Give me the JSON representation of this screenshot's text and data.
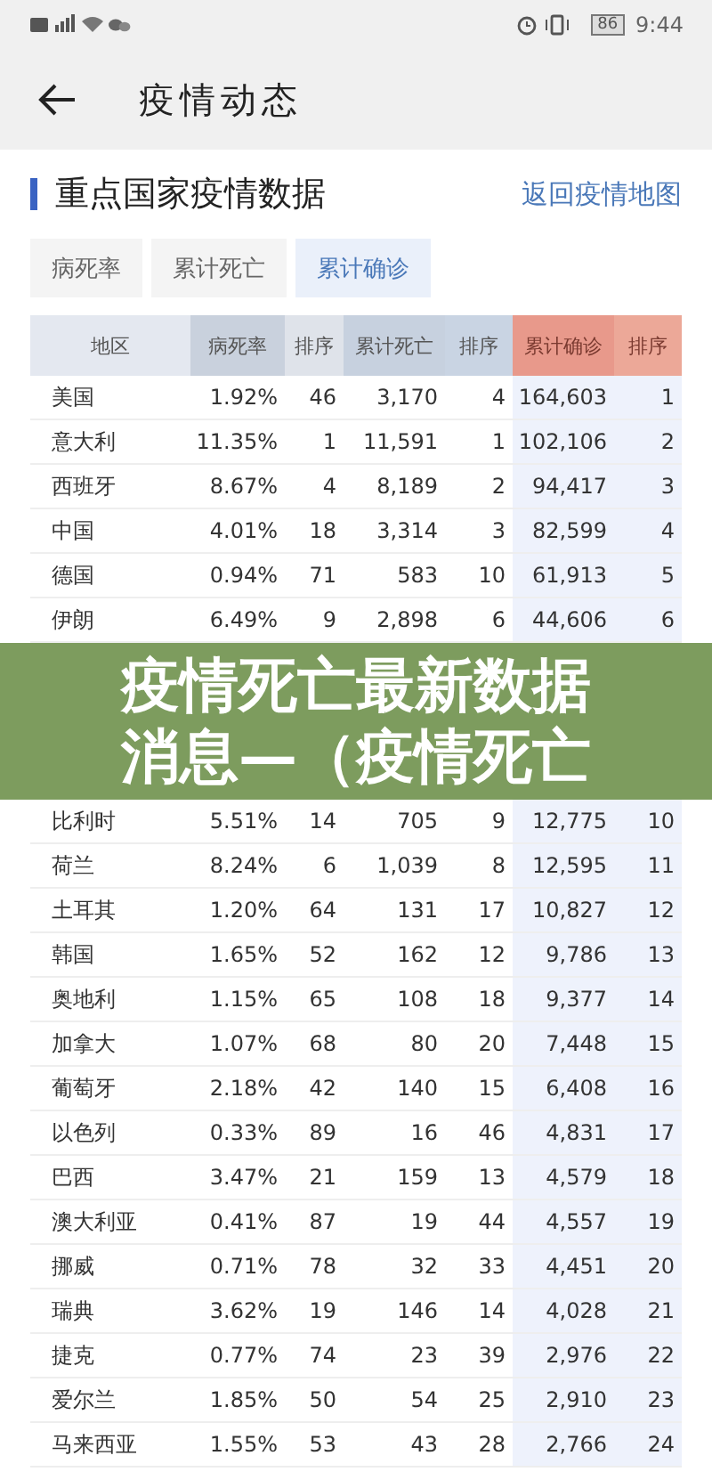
{
  "status_bar": {
    "battery": "86",
    "time": "9:44"
  },
  "header": {
    "title": "疫情动态"
  },
  "section": {
    "title": "重点国家疫情数据",
    "link": "返回疫情地图"
  },
  "tabs": [
    {
      "label": "病死率",
      "selected": false
    },
    {
      "label": "累计死亡",
      "selected": false
    },
    {
      "label": "累计确诊",
      "selected": true
    }
  ],
  "table": {
    "columns": [
      {
        "label": "地区",
        "sorted": false
      },
      {
        "label": "病死率",
        "sorted": false
      },
      {
        "label": "排序",
        "sorted": false
      },
      {
        "label": "累计死亡",
        "sorted": false
      },
      {
        "label": "排序",
        "sorted": false
      },
      {
        "label": "累计确诊",
        "sorted": true
      },
      {
        "label": "排序",
        "sorted": true
      }
    ],
    "rows": [
      [
        "美国",
        "1.92%",
        "46",
        "3,170",
        "4",
        "164,603",
        "1"
      ],
      [
        "意大利",
        "11.35%",
        "1",
        "11,591",
        "1",
        "102,106",
        "2"
      ],
      [
        "西班牙",
        "8.67%",
        "4",
        "8,189",
        "2",
        "94,417",
        "3"
      ],
      [
        "中国",
        "4.01%",
        "18",
        "3,314",
        "3",
        "82,599",
        "4"
      ],
      [
        "德国",
        "0.94%",
        "71",
        "583",
        "10",
        "61,913",
        "5"
      ],
      [
        "伊朗",
        "6.49%",
        "9",
        "2,898",
        "6",
        "44,606",
        "6"
      ]
    ],
    "rows_below_banner": [
      [
        "比利时",
        "5.51%",
        "14",
        "705",
        "9",
        "12,775",
        "10"
      ],
      [
        "荷兰",
        "8.24%",
        "6",
        "1,039",
        "8",
        "12,595",
        "11"
      ],
      [
        "土耳其",
        "1.20%",
        "64",
        "131",
        "17",
        "10,827",
        "12"
      ],
      [
        "韩国",
        "1.65%",
        "52",
        "162",
        "12",
        "9,786",
        "13"
      ],
      [
        "奥地利",
        "1.15%",
        "65",
        "108",
        "18",
        "9,377",
        "14"
      ],
      [
        "加拿大",
        "1.07%",
        "68",
        "80",
        "20",
        "7,448",
        "15"
      ],
      [
        "葡萄牙",
        "2.18%",
        "42",
        "140",
        "15",
        "6,408",
        "16"
      ],
      [
        "以色列",
        "0.33%",
        "89",
        "16",
        "46",
        "4,831",
        "17"
      ],
      [
        "巴西",
        "3.47%",
        "21",
        "159",
        "13",
        "4,579",
        "18"
      ],
      [
        "澳大利亚",
        "0.41%",
        "87",
        "19",
        "44",
        "4,557",
        "19"
      ],
      [
        "挪威",
        "0.71%",
        "78",
        "32",
        "33",
        "4,451",
        "20"
      ],
      [
        "瑞典",
        "3.62%",
        "19",
        "146",
        "14",
        "4,028",
        "21"
      ],
      [
        "捷克",
        "0.77%",
        "74",
        "23",
        "39",
        "2,976",
        "22"
      ],
      [
        "爱尔兰",
        "1.85%",
        "50",
        "54",
        "25",
        "2,910",
        "23"
      ],
      [
        "马来西亚",
        "1.55%",
        "53",
        "43",
        "28",
        "2,766",
        "24"
      ]
    ]
  },
  "banner": {
    "title": "疫情死亡最新数据消息—（疫情死亡"
  }
}
